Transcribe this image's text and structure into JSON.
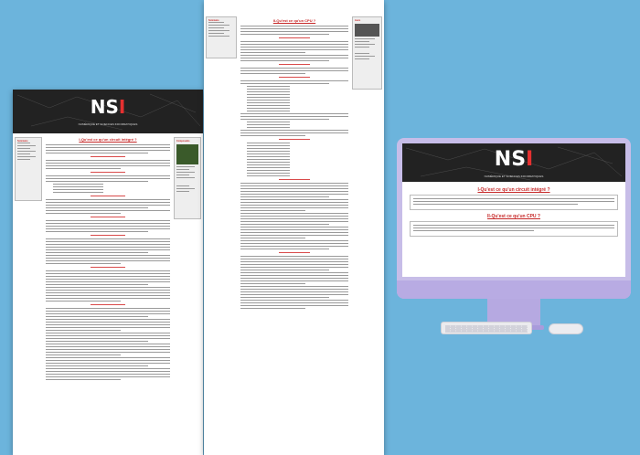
{
  "logo": {
    "text_n": "N",
    "text_s": "S",
    "text_i": "I",
    "subtitle": "NUMÉRIQUE ET SCIENCES INFORMATIQUES"
  },
  "page1": {
    "side_left_title": "Sommaire",
    "side_right_title": "Composants",
    "heading": "I-Qu'est ce qu'un circuit intégré ?"
  },
  "page2": {
    "side_left_title": "Sommaire",
    "side_right_title": "Liens",
    "heading": "II-Qu'est ce qu'un CPU ?"
  },
  "imac": {
    "heading1": "I-Qu'est ce qu'un circuit intégré ?",
    "heading2": "II-Qu'est ce qu'un CPU ?"
  },
  "colors": {
    "background": "#6cb4dc",
    "accent": "#c62828",
    "imac": "#c7bde8"
  }
}
